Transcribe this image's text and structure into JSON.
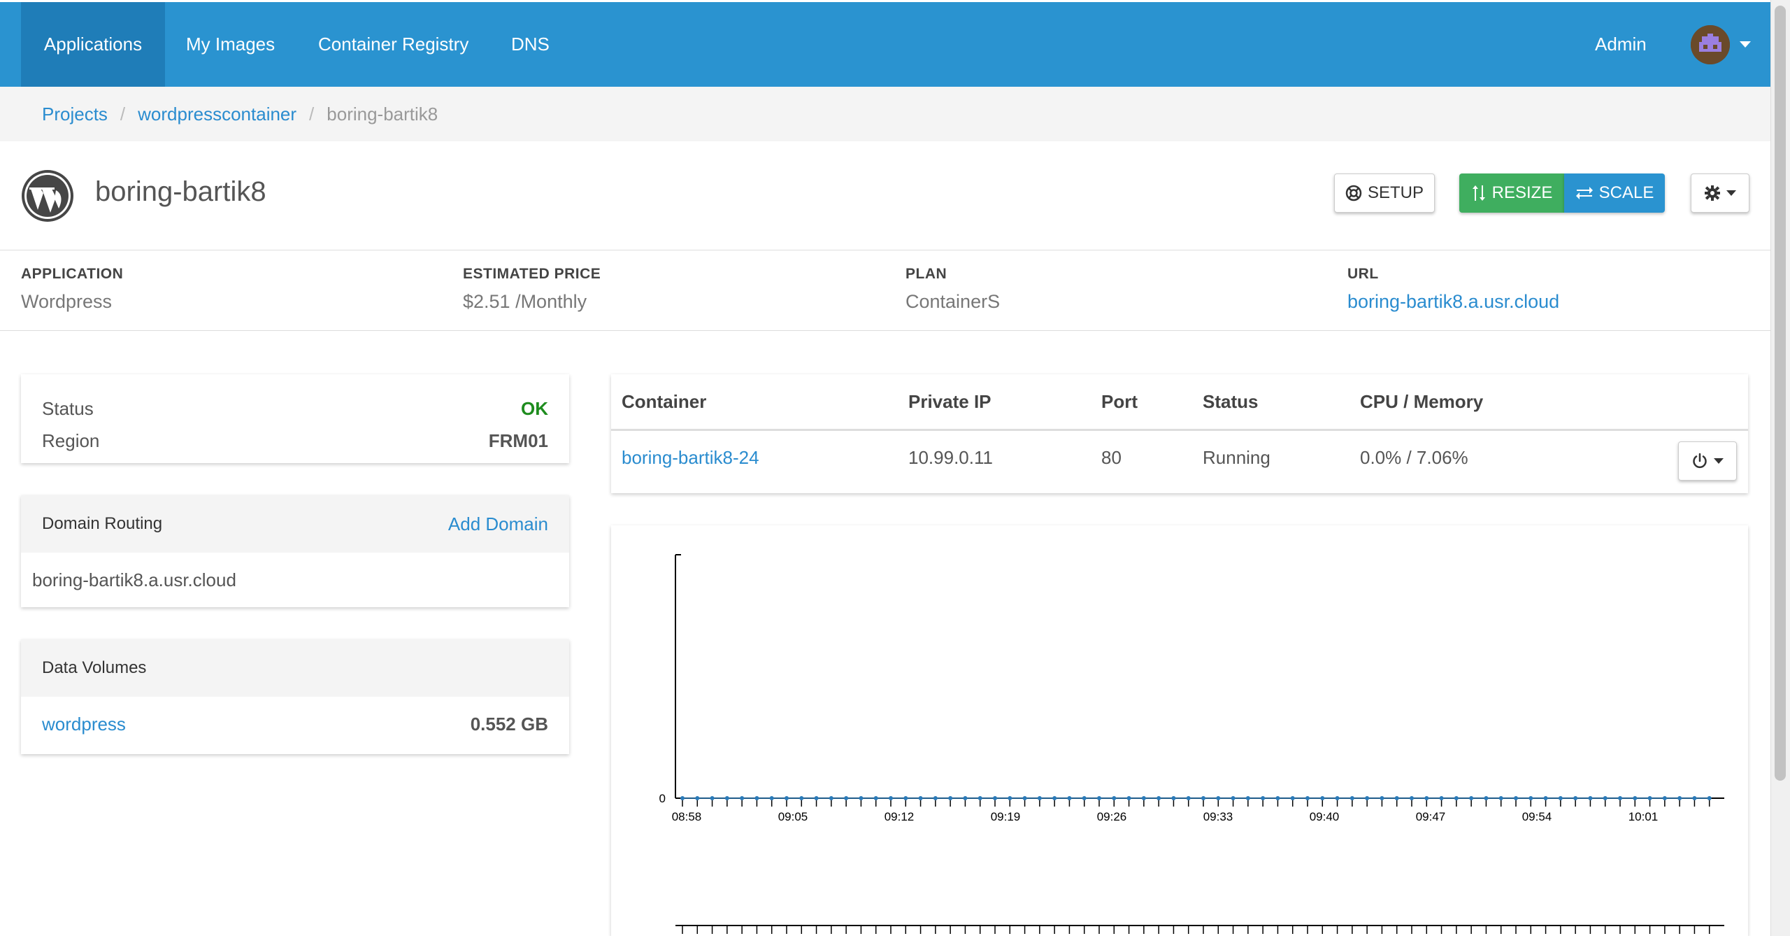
{
  "nav": {
    "items": [
      "Applications",
      "My Images",
      "Container Registry",
      "DNS"
    ],
    "user_label": "Admin"
  },
  "breadcrumb": {
    "items": [
      "Projects",
      "wordpresscontainer"
    ],
    "current": "boring-bartik8"
  },
  "header": {
    "title": "boring-bartik8",
    "setup_label": "SETUP",
    "resize_label": "RESIZE",
    "scale_label": "SCALE"
  },
  "info": {
    "application_label": "APPLICATION",
    "application_value": "Wordpress",
    "price_label": "ESTIMATED PRICE",
    "price_value": "$2.51 /Monthly",
    "plan_label": "PLAN",
    "plan_value": "ContainerS",
    "url_label": "URL",
    "url_value": "boring-bartik8.a.usr.cloud"
  },
  "status_panel": {
    "status_label": "Status",
    "status_value": "OK",
    "region_label": "Region",
    "region_value": "FRM01"
  },
  "domain_panel": {
    "title": "Domain Routing",
    "add_label": "Add Domain",
    "domain": "boring-bartik8.a.usr.cloud"
  },
  "volumes_panel": {
    "title": "Data Volumes",
    "volume_name": "wordpress",
    "volume_size": "0.552 GB"
  },
  "container_table": {
    "headers": [
      "Container",
      "Private IP",
      "Port",
      "Status",
      "CPU / Memory"
    ],
    "row": {
      "container": "boring-bartik8-24",
      "ip": "10.99.0.11",
      "port": "80",
      "status": "Running",
      "cpu_memory": "0.0% / 7.06%"
    }
  },
  "chart_data": {
    "type": "line",
    "x_tick_labels": [
      "08:58",
      "09:05",
      "09:12",
      "09:19",
      "09:26",
      "09:33",
      "09:40",
      "09:47",
      "09:54",
      "10:01"
    ],
    "y_tick_labels": [
      "0"
    ],
    "point_count": 70,
    "values": [
      0,
      0,
      0,
      0,
      0,
      0,
      0,
      0,
      0,
      0,
      0,
      0,
      0,
      0,
      0,
      0,
      0,
      0,
      0,
      0,
      0,
      0,
      0,
      0,
      0,
      0,
      0,
      0,
      0,
      0,
      0,
      0,
      0,
      0,
      0,
      0,
      0,
      0,
      0,
      0,
      0,
      0,
      0,
      0,
      0,
      0,
      0,
      0,
      0,
      0,
      0,
      0,
      0,
      0,
      0,
      0,
      0,
      0,
      0,
      0,
      0,
      0,
      0,
      0,
      0,
      0,
      0,
      0,
      0,
      0
    ],
    "series_color": "#2a7ab8"
  }
}
